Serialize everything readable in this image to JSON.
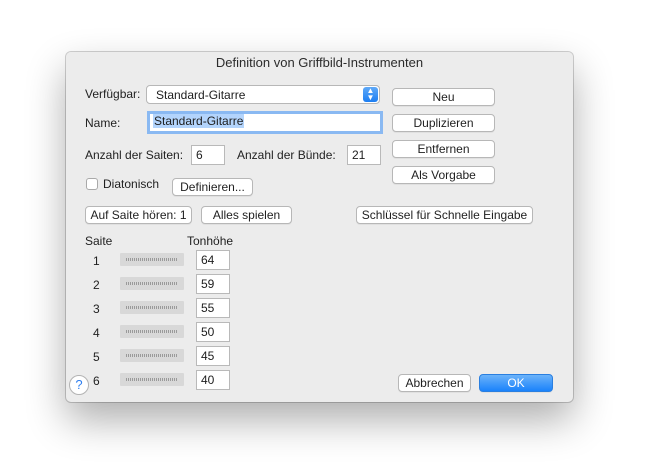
{
  "dialog": {
    "title": "Definition von Griffbild-Instrumenten",
    "available_label": "Verfügbar:",
    "available_value": "Standard-Gitarre",
    "name_label": "Name:",
    "name_value": "Standard-Gitarre",
    "strings_label": "Anzahl der Saiten:",
    "strings_value": "6",
    "frets_label": "Anzahl der Bünde:",
    "frets_value": "21",
    "diatonic_label": "Diatonisch",
    "diatonic_checked": false,
    "define_button": "Definieren...",
    "side_buttons": {
      "new": "Neu",
      "duplicate": "Duplizieren",
      "remove": "Entfernen",
      "default": "Als Vorgabe"
    },
    "listen_button": "Auf Saite hören: 1",
    "play_all_button": "Alles spielen",
    "key_button": "Schlüssel für Schnelle Eingabe",
    "string_header": "Saite",
    "pitch_header": "Tonhöhe",
    "rows": [
      {
        "string": "1",
        "pitch": "64"
      },
      {
        "string": "2",
        "pitch": "59"
      },
      {
        "string": "3",
        "pitch": "55"
      },
      {
        "string": "4",
        "pitch": "50"
      },
      {
        "string": "5",
        "pitch": "45"
      },
      {
        "string": "6",
        "pitch": "40"
      }
    ],
    "help_icon": "?",
    "cancel_button": "Abbrechen",
    "ok_button": "OK",
    "accent_color": "#1a82fb"
  }
}
